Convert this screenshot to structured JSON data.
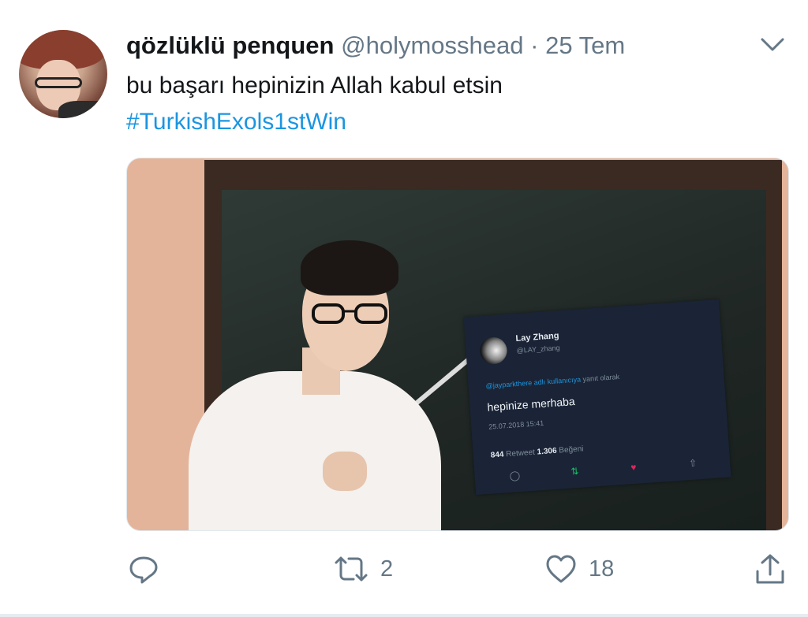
{
  "tweet": {
    "display_name": "qözlüklü penquen",
    "handle": "@holymosshead",
    "separator": "·",
    "date": "25 Tem",
    "text": "bu başarı hepinizin Allah kabul etsin",
    "hashtag": "#TurkishExols1stWin",
    "actions": {
      "retweets": "2",
      "likes": "18"
    }
  },
  "embedded_tweet": {
    "name": "Lay Zhang",
    "handle": "@LAY_zhang",
    "reply_link": "@jayparkthere adlı kullanıcıya",
    "reply_suffix": "yanıt olarak",
    "text": "hepinize merhaba",
    "timestamp": "25.07.2018 15:41",
    "retweet_count": "844",
    "retweet_label": "Retweet",
    "like_count": "1.306",
    "like_label": "Beğeni"
  },
  "colors": {
    "link": "#1b95e0",
    "secondary_text": "#657786",
    "embedded_bg": "#1a2436",
    "heart": "#e0245e",
    "retweet_green": "#17bf63"
  },
  "icons": [
    "chevron-down-icon",
    "reply-icon",
    "retweet-icon",
    "like-icon",
    "share-icon"
  ]
}
